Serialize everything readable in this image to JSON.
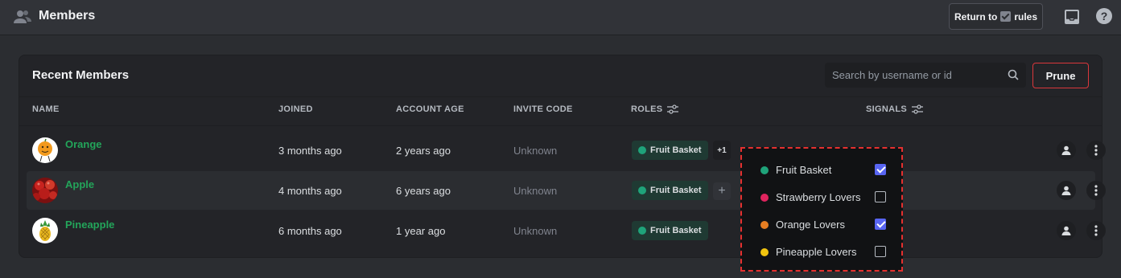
{
  "header": {
    "title": "Members",
    "return_label_prefix": "Return to",
    "return_label_suffix": "rules"
  },
  "panel": {
    "title": "Recent Members",
    "search_placeholder": "Search by username or id",
    "prune_label": "Prune",
    "columns": {
      "name": "NAME",
      "joined": "JOINED",
      "account_age": "ACCOUNT AGE",
      "invite_code": "INVITE CODE",
      "roles": "ROLES",
      "signals": "SIGNALS"
    }
  },
  "members": [
    {
      "name": "Orange",
      "joined": "3 months ago",
      "account_age": "2 years ago",
      "invite_code": "Unknown",
      "role": "Fruit Basket",
      "extra_roles": "+1",
      "avatar": "orange"
    },
    {
      "name": "Apple",
      "joined": "4 months ago",
      "account_age": "6 years ago",
      "invite_code": "Unknown",
      "role": "Fruit Basket",
      "extra_roles": "+",
      "avatar": "apple"
    },
    {
      "name": "Pineapple",
      "joined": "6 months ago",
      "account_age": "1 year ago",
      "invite_code": "Unknown",
      "role": "Fruit Basket",
      "extra_roles": "",
      "avatar": "pineapple"
    }
  ],
  "role_dropdown": [
    {
      "label": "Fruit Basket",
      "color": "#1fa37a",
      "checked": true
    },
    {
      "label": "Strawberry Lovers",
      "color": "#e0245e",
      "checked": false
    },
    {
      "label": "Orange Lovers",
      "color": "#e67e22",
      "checked": true
    },
    {
      "label": "Pineapple Lovers",
      "color": "#f1c40f",
      "checked": false
    }
  ],
  "colors": {
    "accent": "#5865f2",
    "username": "#23a55a",
    "role_dot": "#1fa37a",
    "danger": "#da373c"
  }
}
